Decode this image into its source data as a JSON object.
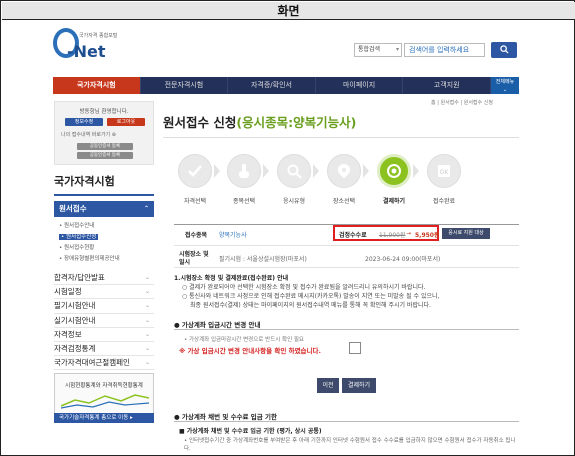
{
  "caption": "화면",
  "logo": {
    "sub": "국가자격 종합포털",
    "name": "-Net"
  },
  "search": {
    "scope": "통합검색",
    "placeholder": "검색어를 입력하세요"
  },
  "gnb": {
    "items": [
      "국가자격시험",
      "전문자격시험",
      "자격증/확인서",
      "마이페이지",
      "고객지원"
    ],
    "all_menu": [
      "전체메뉴",
      "⌄"
    ]
  },
  "breadcrumb": "홈 | 원서접수 | 원서접수 신청",
  "login": {
    "hello": "방동항님 환영합니다.",
    "info_btn": "정보수정",
    "logout_btn": "로그아웃",
    "recent": "나의 접수내역 바로가기 ⊕",
    "link1": "공동인증서 등록",
    "link2": "공동인증서 등록"
  },
  "sidebar": {
    "title": "국가자격시험",
    "active": "원서접수",
    "subitems": [
      "• 원서접수안내",
      "• 원서접수신청",
      "• 원서접수현황",
      "• 장애유형별편의제공안내"
    ],
    "menu": [
      "합격자/답안발표",
      "시험일정",
      "필기시험안내",
      "실기시험안내",
      "자격정보",
      "자격검정통계",
      "국가자격대여근절캠페인"
    ],
    "banner": "시험현황통계와 자격취득현황통계",
    "banner_link": "국가기술자격통계 총으로 이동 ▸"
  },
  "page": {
    "title_main": "원서접수 신청",
    "title_sub": "(응시종목:양복기능사)"
  },
  "steps": [
    "자격선택",
    "종목선택",
    "응시유형",
    "장소선택",
    "결제하기",
    "접수완료"
  ],
  "form": {
    "subject_label": "접수종목",
    "subject_value": "양복기능사",
    "fee_label": "검정수수료",
    "fee_old": "11,900원",
    "fee_arrow": "→",
    "fee_new": "5,950원",
    "discount_btn": "응시료 지원 대상",
    "place_label": "시험장소 및 일시",
    "place_value": "필기시험 : 서울상설시험장(마포서)",
    "place_date": "2023-06-24 09:00(마포서)"
  },
  "notes": {
    "heading": "1.시험장소 확정 및 결제완료(접수완료) 안내",
    "l1": "○ 결제가 완료되어야 선택한 시험장소 확정 및 접수가 완료됨을 알려드리니 유의하시기 바랍니다.",
    "l2": "○ 통신사와 네트워크 사정으로 인해 접수완료 메시지(카카오톡) 발송이 지연 또는 미발송 될 수 있으니,",
    "l3": "최종 원서접수(결제) 상태는 마이페이지의 원서접수내역 메뉴를 통해 꼭 확인해 주시기 바랍니다."
  },
  "section2": {
    "title": "● 가상계좌 입금시간 변경 안내",
    "gray": "• 가상계좌 입금마감시간 변경으로 반드시 확인 필요",
    "red": "※ 가상 입금시간 변경 안내사항을 확인 하였습니다."
  },
  "buttons": {
    "prev": "이전",
    "confirm": "결제하기"
  },
  "section3": {
    "title": "● 가상계좌 채번 및 수수료 입금 기한",
    "sub": "■ 가상계좌 채번 및 수수료 입금 기한 (평가, 상시 공통)",
    "text": "• 인터넷접수기간 중 가상계좌번호를 부여받은 후 아래 기한까지 인터넷 수험원서 접수 수수료를 입금하지 않으면 수험원서 접수가 자동취소 됩니다."
  },
  "colors": {
    "brand_navy": "#23315a",
    "accent_red": "#c7371b",
    "brand_blue": "#2d57a3",
    "step_green": "#8cc21f",
    "title_green": "#6a9e1e"
  }
}
